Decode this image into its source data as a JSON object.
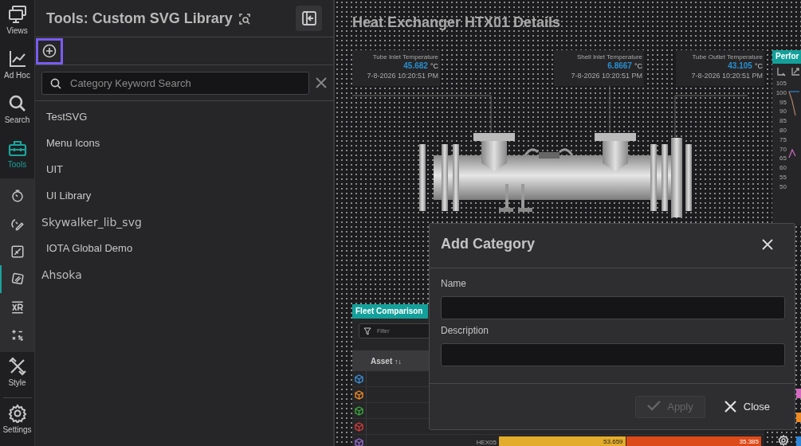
{
  "rail": {
    "top_items": [
      {
        "label": "Views",
        "selected": false
      },
      {
        "label": "Ad Hoc",
        "selected": false
      },
      {
        "label": "Search",
        "selected": false
      },
      {
        "label": "Tools",
        "selected": true
      }
    ],
    "tool_items": [
      {
        "selected": false
      },
      {
        "selected": false
      },
      {
        "selected": false
      },
      {
        "selected": true
      },
      {
        "selected": false
      },
      {
        "selected": false
      }
    ],
    "bottom_items": [
      {
        "label": "Style",
        "selected": false
      },
      {
        "label": "Settings",
        "selected": false
      }
    ]
  },
  "panel": {
    "title": "Tools: Custom SVG Library",
    "search": {
      "placeholder": "Category Keyword Search"
    },
    "categories": [
      {
        "label": "TestSVG",
        "kind": "child"
      },
      {
        "label": "Menu Icons",
        "kind": "child"
      },
      {
        "label": "UIT",
        "kind": "child"
      },
      {
        "label": "UI Library",
        "kind": "child"
      },
      {
        "label": "Skywalker_lib_svg",
        "kind": "root"
      },
      {
        "label": "IOTA Global Demo",
        "kind": "child"
      },
      {
        "label": "Ahsoka",
        "kind": "root"
      }
    ]
  },
  "canvas": {
    "title": "Heat Exchanger HTX01 Details",
    "readings": [
      {
        "label": "Tube Inlet Temperature",
        "value": "45.682",
        "unit": "°C",
        "time": "7-8-2026 10:20:51 PM"
      },
      {
        "label": "Shell Inlet Temperature",
        "value": "6.8667",
        "unit": "°C",
        "time": "7-8-2026 10:20:51 PM"
      },
      {
        "label": "Tube Outlet Temperature",
        "value": "43.105",
        "unit": "°C",
        "time": "7-8-2026 10:20:51 PM"
      }
    ],
    "performance": {
      "title": "Perfor",
      "y_labels": [
        "105",
        "100",
        "95",
        "90",
        "85",
        "80",
        "75",
        "70",
        "65",
        "60",
        "55",
        "50"
      ]
    },
    "fleet": {
      "title": "Fleet Comparison",
      "filter": {
        "placeholder": "Filter"
      },
      "column": "Asset",
      "sort_icon": "↑↓",
      "rows": [
        {
          "color": "#3a8fd6"
        },
        {
          "color": "#f08a24"
        },
        {
          "color": "#3aa83a"
        },
        {
          "color": "#d63a3a"
        },
        {
          "color": "#9a6ad6",
          "asset": "HEX05",
          "bars": [
            {
              "value": "53.659",
              "color": "#e3ac2b"
            },
            {
              "value": "35.385",
              "color": "#dd4a1a"
            }
          ]
        }
      ]
    },
    "legend": [
      {
        "color": "#d46ac0"
      },
      {
        "color": "#f08a24"
      },
      {
        "color": "#2f86d6"
      }
    ]
  },
  "dialog": {
    "title": "Add Category",
    "fields": [
      {
        "label": "Name"
      },
      {
        "label": "Description"
      }
    ],
    "buttons": [
      {
        "label": "Apply",
        "kind": "apply",
        "disabled": true
      },
      {
        "label": "Close",
        "kind": "close",
        "disabled": false
      }
    ]
  }
}
